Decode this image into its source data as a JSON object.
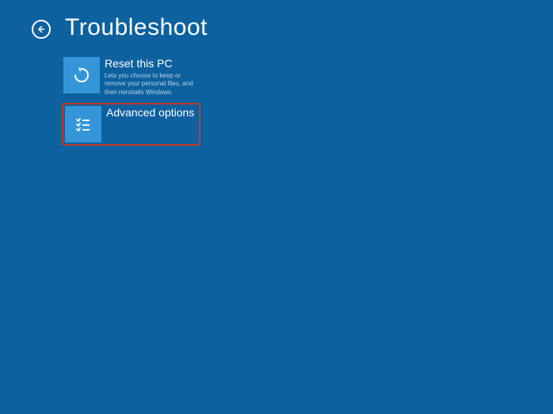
{
  "page": {
    "title": "Troubleshoot"
  },
  "options": [
    {
      "title": "Reset this PC",
      "description": "Lets you choose to keep or remove your personal files, and then reinstalls Windows.",
      "icon": "reset",
      "highlighted": false
    },
    {
      "title": "Advanced options",
      "description": "",
      "icon": "list",
      "highlighted": true
    }
  ]
}
